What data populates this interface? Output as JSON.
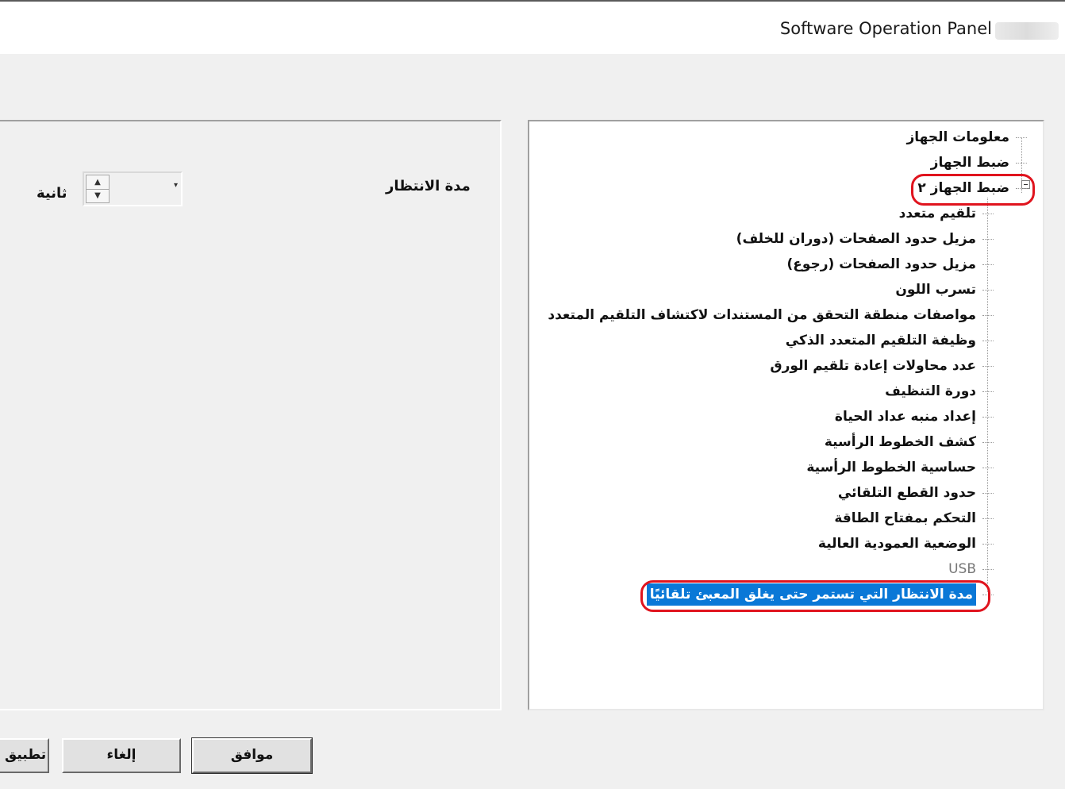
{
  "window": {
    "title": "Software Operation Panel"
  },
  "tree": {
    "items": [
      {
        "label": "معلومات الجهاز",
        "level": 1
      },
      {
        "label": "ضبط الجهاز",
        "level": 1
      },
      {
        "label": "ضبط الجهاز ٢",
        "level": 1,
        "expanded": true,
        "highlighted": true
      },
      {
        "label": "تلقيم متعدد",
        "level": 2
      },
      {
        "label": "مزيل حدود الصفحات (دوران للخلف)",
        "level": 2
      },
      {
        "label": "مزيل حدود الصفحات (رجوع)",
        "level": 2
      },
      {
        "label": "تسرب اللون",
        "level": 2
      },
      {
        "label": "مواصفات منطقة التحقق من المستندات لاكتشاف التلقيم المتعدد",
        "level": 2
      },
      {
        "label": "وظيفة التلقيم المتعدد الذكي",
        "level": 2
      },
      {
        "label": "عدد محاولات إعادة تلقيم الورق",
        "level": 2
      },
      {
        "label": "دورة التنظيف",
        "level": 2
      },
      {
        "label": "إعداد منبه عداد الحياة",
        "level": 2
      },
      {
        "label": "كشف الخطوط الرأسية",
        "level": 2
      },
      {
        "label": "حساسية الخطوط الرأسية",
        "level": 2
      },
      {
        "label": "حدود القطع التلقائي",
        "level": 2
      },
      {
        "label": "التحكم بمفتاح الطاقة",
        "level": 2
      },
      {
        "label": "الوضعية العمودية العالية",
        "level": 2
      },
      {
        "label": "USB",
        "level": 2
      },
      {
        "label": "مدة الانتظار التي تستمر حتى يغلق المعبئ تلقائيًا",
        "level": 2,
        "selected": true,
        "highlighted": true
      }
    ]
  },
  "settings": {
    "wait_label": "مدة الانتظار",
    "unit_label": "ثانية",
    "spin_value": ""
  },
  "buttons": {
    "ok": "موافق",
    "cancel": "إلغاء",
    "apply": "تطبيق"
  },
  "colors": {
    "selection": "#0a78d7",
    "highlight_ring": "#e0141e"
  }
}
